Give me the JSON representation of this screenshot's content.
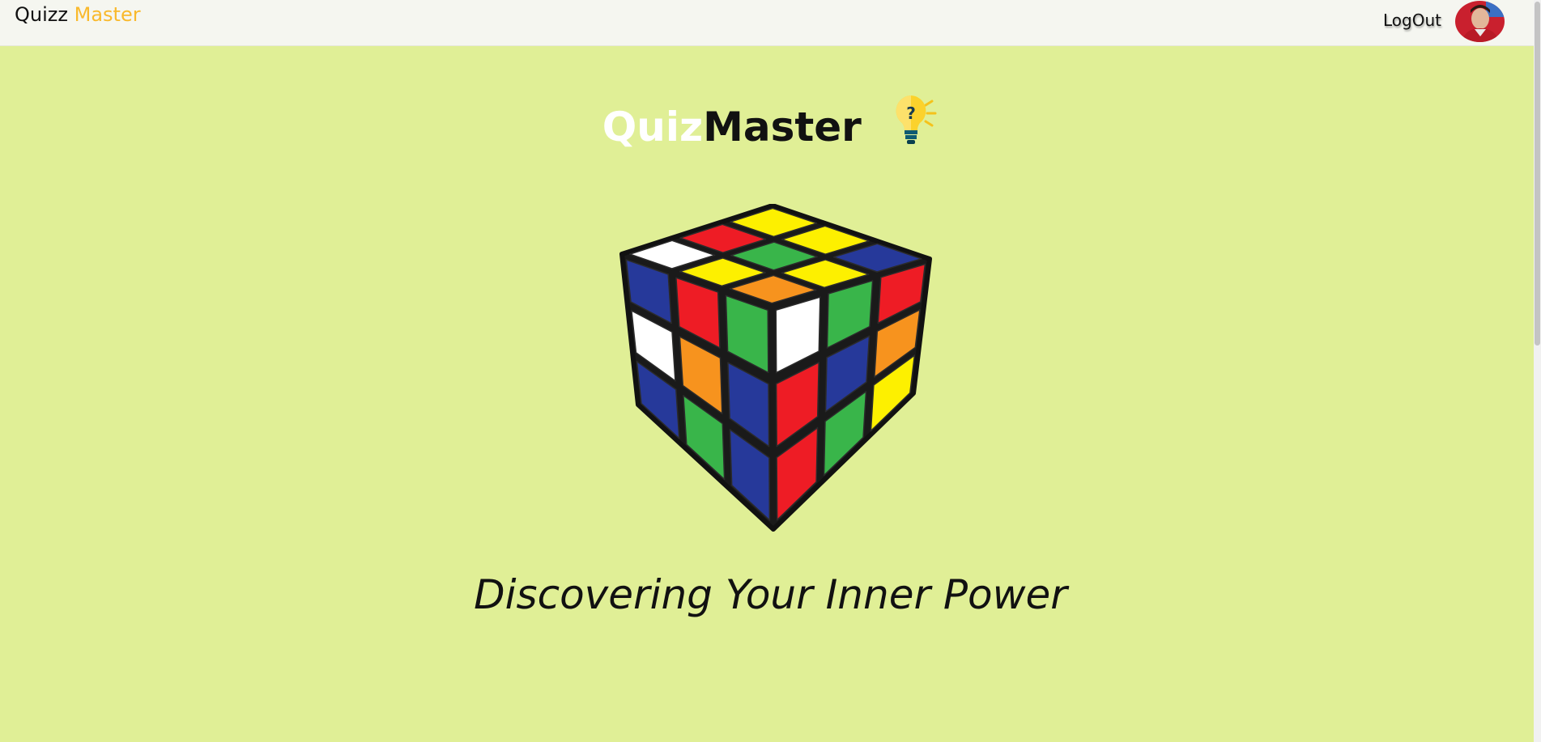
{
  "navbar": {
    "brand_part1": "Quizz",
    "brand_part2": "Master",
    "logout_label": "LogOut",
    "avatar_alt": "user-avatar"
  },
  "hero": {
    "title_part1": "Quiz",
    "title_part2": "Master",
    "bulb_icon": "lightbulb-question-icon",
    "image": "rubiks-cube",
    "tagline": "Discovering Your Inner Power"
  },
  "colors": {
    "background": "#e0ef96",
    "navbar": "#f5f6f0",
    "brand_accent": "#f9b92c",
    "title_quiz": "#ffffff"
  }
}
